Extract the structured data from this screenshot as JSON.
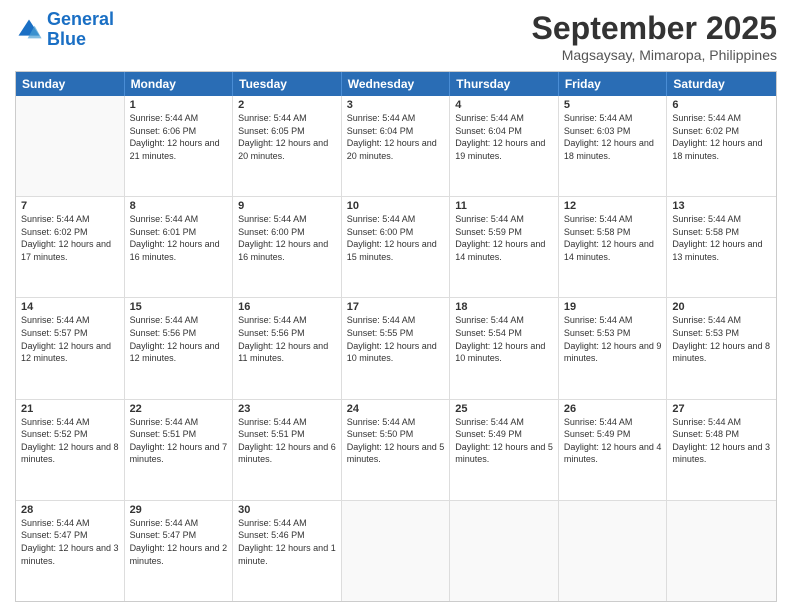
{
  "logo": {
    "line1": "General",
    "line2": "Blue"
  },
  "title": "September 2025",
  "location": "Magsaysay, Mimaropa, Philippines",
  "weekdays": [
    "Sunday",
    "Monday",
    "Tuesday",
    "Wednesday",
    "Thursday",
    "Friday",
    "Saturday"
  ],
  "weeks": [
    [
      {
        "day": "",
        "sunrise": "",
        "sunset": "",
        "daylight": ""
      },
      {
        "day": "1",
        "sunrise": "Sunrise: 5:44 AM",
        "sunset": "Sunset: 6:06 PM",
        "daylight": "Daylight: 12 hours and 21 minutes."
      },
      {
        "day": "2",
        "sunrise": "Sunrise: 5:44 AM",
        "sunset": "Sunset: 6:05 PM",
        "daylight": "Daylight: 12 hours and 20 minutes."
      },
      {
        "day": "3",
        "sunrise": "Sunrise: 5:44 AM",
        "sunset": "Sunset: 6:04 PM",
        "daylight": "Daylight: 12 hours and 20 minutes."
      },
      {
        "day": "4",
        "sunrise": "Sunrise: 5:44 AM",
        "sunset": "Sunset: 6:04 PM",
        "daylight": "Daylight: 12 hours and 19 minutes."
      },
      {
        "day": "5",
        "sunrise": "Sunrise: 5:44 AM",
        "sunset": "Sunset: 6:03 PM",
        "daylight": "Daylight: 12 hours and 18 minutes."
      },
      {
        "day": "6",
        "sunrise": "Sunrise: 5:44 AM",
        "sunset": "Sunset: 6:02 PM",
        "daylight": "Daylight: 12 hours and 18 minutes."
      }
    ],
    [
      {
        "day": "7",
        "sunrise": "Sunrise: 5:44 AM",
        "sunset": "Sunset: 6:02 PM",
        "daylight": "Daylight: 12 hours and 17 minutes."
      },
      {
        "day": "8",
        "sunrise": "Sunrise: 5:44 AM",
        "sunset": "Sunset: 6:01 PM",
        "daylight": "Daylight: 12 hours and 16 minutes."
      },
      {
        "day": "9",
        "sunrise": "Sunrise: 5:44 AM",
        "sunset": "Sunset: 6:00 PM",
        "daylight": "Daylight: 12 hours and 16 minutes."
      },
      {
        "day": "10",
        "sunrise": "Sunrise: 5:44 AM",
        "sunset": "Sunset: 6:00 PM",
        "daylight": "Daylight: 12 hours and 15 minutes."
      },
      {
        "day": "11",
        "sunrise": "Sunrise: 5:44 AM",
        "sunset": "Sunset: 5:59 PM",
        "daylight": "Daylight: 12 hours and 14 minutes."
      },
      {
        "day": "12",
        "sunrise": "Sunrise: 5:44 AM",
        "sunset": "Sunset: 5:58 PM",
        "daylight": "Daylight: 12 hours and 14 minutes."
      },
      {
        "day": "13",
        "sunrise": "Sunrise: 5:44 AM",
        "sunset": "Sunset: 5:58 PM",
        "daylight": "Daylight: 12 hours and 13 minutes."
      }
    ],
    [
      {
        "day": "14",
        "sunrise": "Sunrise: 5:44 AM",
        "sunset": "Sunset: 5:57 PM",
        "daylight": "Daylight: 12 hours and 12 minutes."
      },
      {
        "day": "15",
        "sunrise": "Sunrise: 5:44 AM",
        "sunset": "Sunset: 5:56 PM",
        "daylight": "Daylight: 12 hours and 12 minutes."
      },
      {
        "day": "16",
        "sunrise": "Sunrise: 5:44 AM",
        "sunset": "Sunset: 5:56 PM",
        "daylight": "Daylight: 12 hours and 11 minutes."
      },
      {
        "day": "17",
        "sunrise": "Sunrise: 5:44 AM",
        "sunset": "Sunset: 5:55 PM",
        "daylight": "Daylight: 12 hours and 10 minutes."
      },
      {
        "day": "18",
        "sunrise": "Sunrise: 5:44 AM",
        "sunset": "Sunset: 5:54 PM",
        "daylight": "Daylight: 12 hours and 10 minutes."
      },
      {
        "day": "19",
        "sunrise": "Sunrise: 5:44 AM",
        "sunset": "Sunset: 5:53 PM",
        "daylight": "Daylight: 12 hours and 9 minutes."
      },
      {
        "day": "20",
        "sunrise": "Sunrise: 5:44 AM",
        "sunset": "Sunset: 5:53 PM",
        "daylight": "Daylight: 12 hours and 8 minutes."
      }
    ],
    [
      {
        "day": "21",
        "sunrise": "Sunrise: 5:44 AM",
        "sunset": "Sunset: 5:52 PM",
        "daylight": "Daylight: 12 hours and 8 minutes."
      },
      {
        "day": "22",
        "sunrise": "Sunrise: 5:44 AM",
        "sunset": "Sunset: 5:51 PM",
        "daylight": "Daylight: 12 hours and 7 minutes."
      },
      {
        "day": "23",
        "sunrise": "Sunrise: 5:44 AM",
        "sunset": "Sunset: 5:51 PM",
        "daylight": "Daylight: 12 hours and 6 minutes."
      },
      {
        "day": "24",
        "sunrise": "Sunrise: 5:44 AM",
        "sunset": "Sunset: 5:50 PM",
        "daylight": "Daylight: 12 hours and 5 minutes."
      },
      {
        "day": "25",
        "sunrise": "Sunrise: 5:44 AM",
        "sunset": "Sunset: 5:49 PM",
        "daylight": "Daylight: 12 hours and 5 minutes."
      },
      {
        "day": "26",
        "sunrise": "Sunrise: 5:44 AM",
        "sunset": "Sunset: 5:49 PM",
        "daylight": "Daylight: 12 hours and 4 minutes."
      },
      {
        "day": "27",
        "sunrise": "Sunrise: 5:44 AM",
        "sunset": "Sunset: 5:48 PM",
        "daylight": "Daylight: 12 hours and 3 minutes."
      }
    ],
    [
      {
        "day": "28",
        "sunrise": "Sunrise: 5:44 AM",
        "sunset": "Sunset: 5:47 PM",
        "daylight": "Daylight: 12 hours and 3 minutes."
      },
      {
        "day": "29",
        "sunrise": "Sunrise: 5:44 AM",
        "sunset": "Sunset: 5:47 PM",
        "daylight": "Daylight: 12 hours and 2 minutes."
      },
      {
        "day": "30",
        "sunrise": "Sunrise: 5:44 AM",
        "sunset": "Sunset: 5:46 PM",
        "daylight": "Daylight: 12 hours and 1 minute."
      },
      {
        "day": "",
        "sunrise": "",
        "sunset": "",
        "daylight": ""
      },
      {
        "day": "",
        "sunrise": "",
        "sunset": "",
        "daylight": ""
      },
      {
        "day": "",
        "sunrise": "",
        "sunset": "",
        "daylight": ""
      },
      {
        "day": "",
        "sunrise": "",
        "sunset": "",
        "daylight": ""
      }
    ]
  ]
}
